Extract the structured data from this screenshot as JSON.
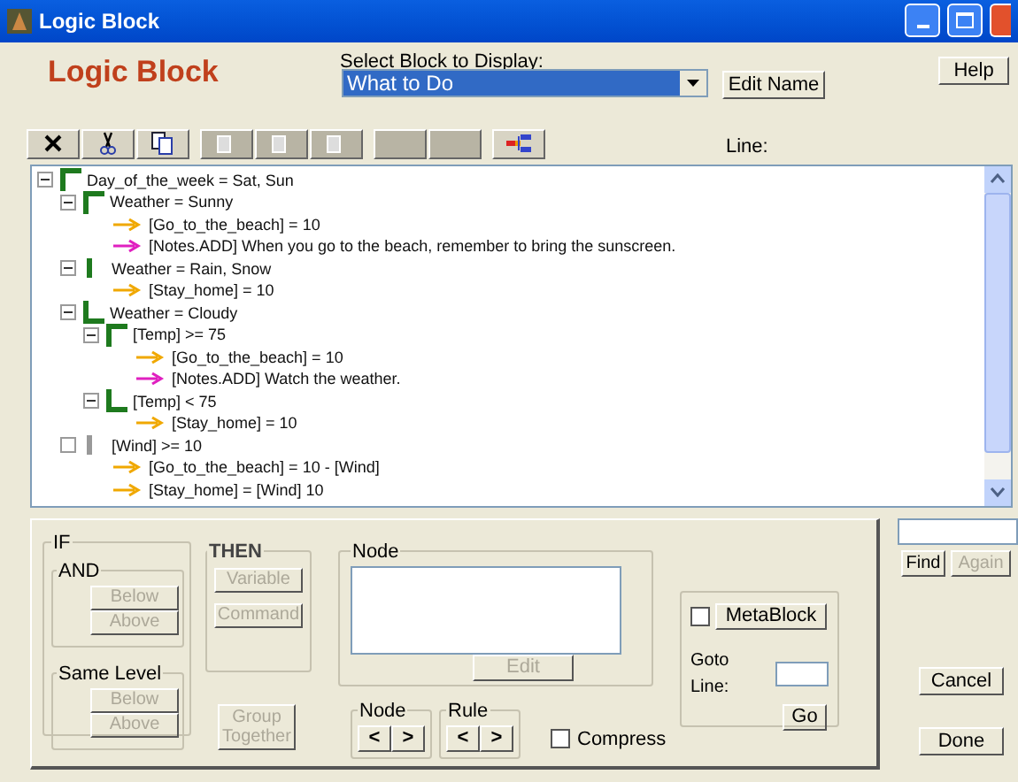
{
  "window": {
    "title": "Logic Block"
  },
  "header": {
    "title": "Logic Block",
    "select_label": "Select Block to Display:",
    "selected_block": "What to Do",
    "edit_name": "Edit Name",
    "help": "Help",
    "line_label": "Line:"
  },
  "toolbar": [
    {
      "kind": "delete",
      "disabled": false
    },
    {
      "kind": "cut",
      "disabled": false
    },
    {
      "kind": "copy",
      "disabled": false
    },
    {
      "kind": "page",
      "disabled": true
    },
    {
      "kind": "page",
      "disabled": true
    },
    {
      "kind": "page",
      "disabled": true
    },
    {
      "kind": "blank",
      "disabled": true
    },
    {
      "kind": "blank",
      "disabled": true
    },
    {
      "kind": "tree",
      "disabled": false
    }
  ],
  "tree": [
    {
      "kind": "open",
      "expanded": true,
      "text": "Day_of_the_week = Sat, Sun",
      "children": [
        {
          "kind": "open",
          "expanded": true,
          "text": "Weather = Sunny",
          "children": [
            {
              "kind": "assign",
              "text": "[Go_to_the_beach] = 10"
            },
            {
              "kind": "note",
              "text": "[Notes.ADD]  When you go to the beach, remember to bring the sunscreen."
            }
          ]
        },
        {
          "kind": "middle",
          "expanded": true,
          "text": "Weather = Rain, Snow",
          "children": [
            {
              "kind": "assign",
              "text": "[Stay_home] = 10"
            }
          ]
        },
        {
          "kind": "close",
          "expanded": true,
          "text": "Weather = Cloudy",
          "children": [
            {
              "kind": "open",
              "expanded": true,
              "text": "[Temp] >= 75",
              "children": [
                {
                  "kind": "assign",
                  "text": "[Go_to_the_beach] = 10"
                },
                {
                  "kind": "note",
                  "text": "[Notes.ADD]  Watch the weather."
                }
              ]
            },
            {
              "kind": "close",
              "expanded": true,
              "text": "[Temp] < 75",
              "children": [
                {
                  "kind": "assign",
                  "text": "[Stay_home] = 10"
                }
              ]
            }
          ]
        },
        {
          "kind": "plain",
          "expanded": false,
          "text": "[Wind] >= 10",
          "children": [
            {
              "kind": "assign",
              "text": "[Go_to_the_beach] = 10 - [Wind]"
            },
            {
              "kind": "assign",
              "text": "[Stay_home] = [Wind]  10"
            }
          ]
        }
      ]
    }
  ],
  "if_group": {
    "label": "IF",
    "and": {
      "label": "AND",
      "buttons": [
        {
          "label": "Below",
          "disabled": true
        },
        {
          "label": "Above",
          "disabled": true
        }
      ]
    },
    "same_level": {
      "label": "Same Level",
      "buttons": [
        {
          "label": "Below",
          "disabled": true
        },
        {
          "label": "Above",
          "disabled": true
        }
      ]
    }
  },
  "then_group": {
    "label": "THEN",
    "buttons": [
      {
        "label": "Variable",
        "disabled": true
      },
      {
        "label": "Command",
        "disabled": true
      }
    ]
  },
  "group_together": {
    "label": "Group Together",
    "disabled": true
  },
  "node_group": {
    "label": "Node",
    "edit": {
      "label": "Edit",
      "disabled": true
    }
  },
  "nav": [
    {
      "label": "Node",
      "prev": "<",
      "next": ">"
    },
    {
      "label": "Rule",
      "prev": "<",
      "next": ">"
    }
  ],
  "compress": {
    "label": "Compress",
    "checked": false
  },
  "metablock": {
    "label": "MetaBlock",
    "checked": false,
    "goto_label": "Goto Line:",
    "go": "Go"
  },
  "find": {
    "find": {
      "label": "Find",
      "disabled": false
    },
    "again": {
      "label": "Again",
      "disabled": true
    }
  },
  "cancel": "Cancel",
  "done": "Done"
}
